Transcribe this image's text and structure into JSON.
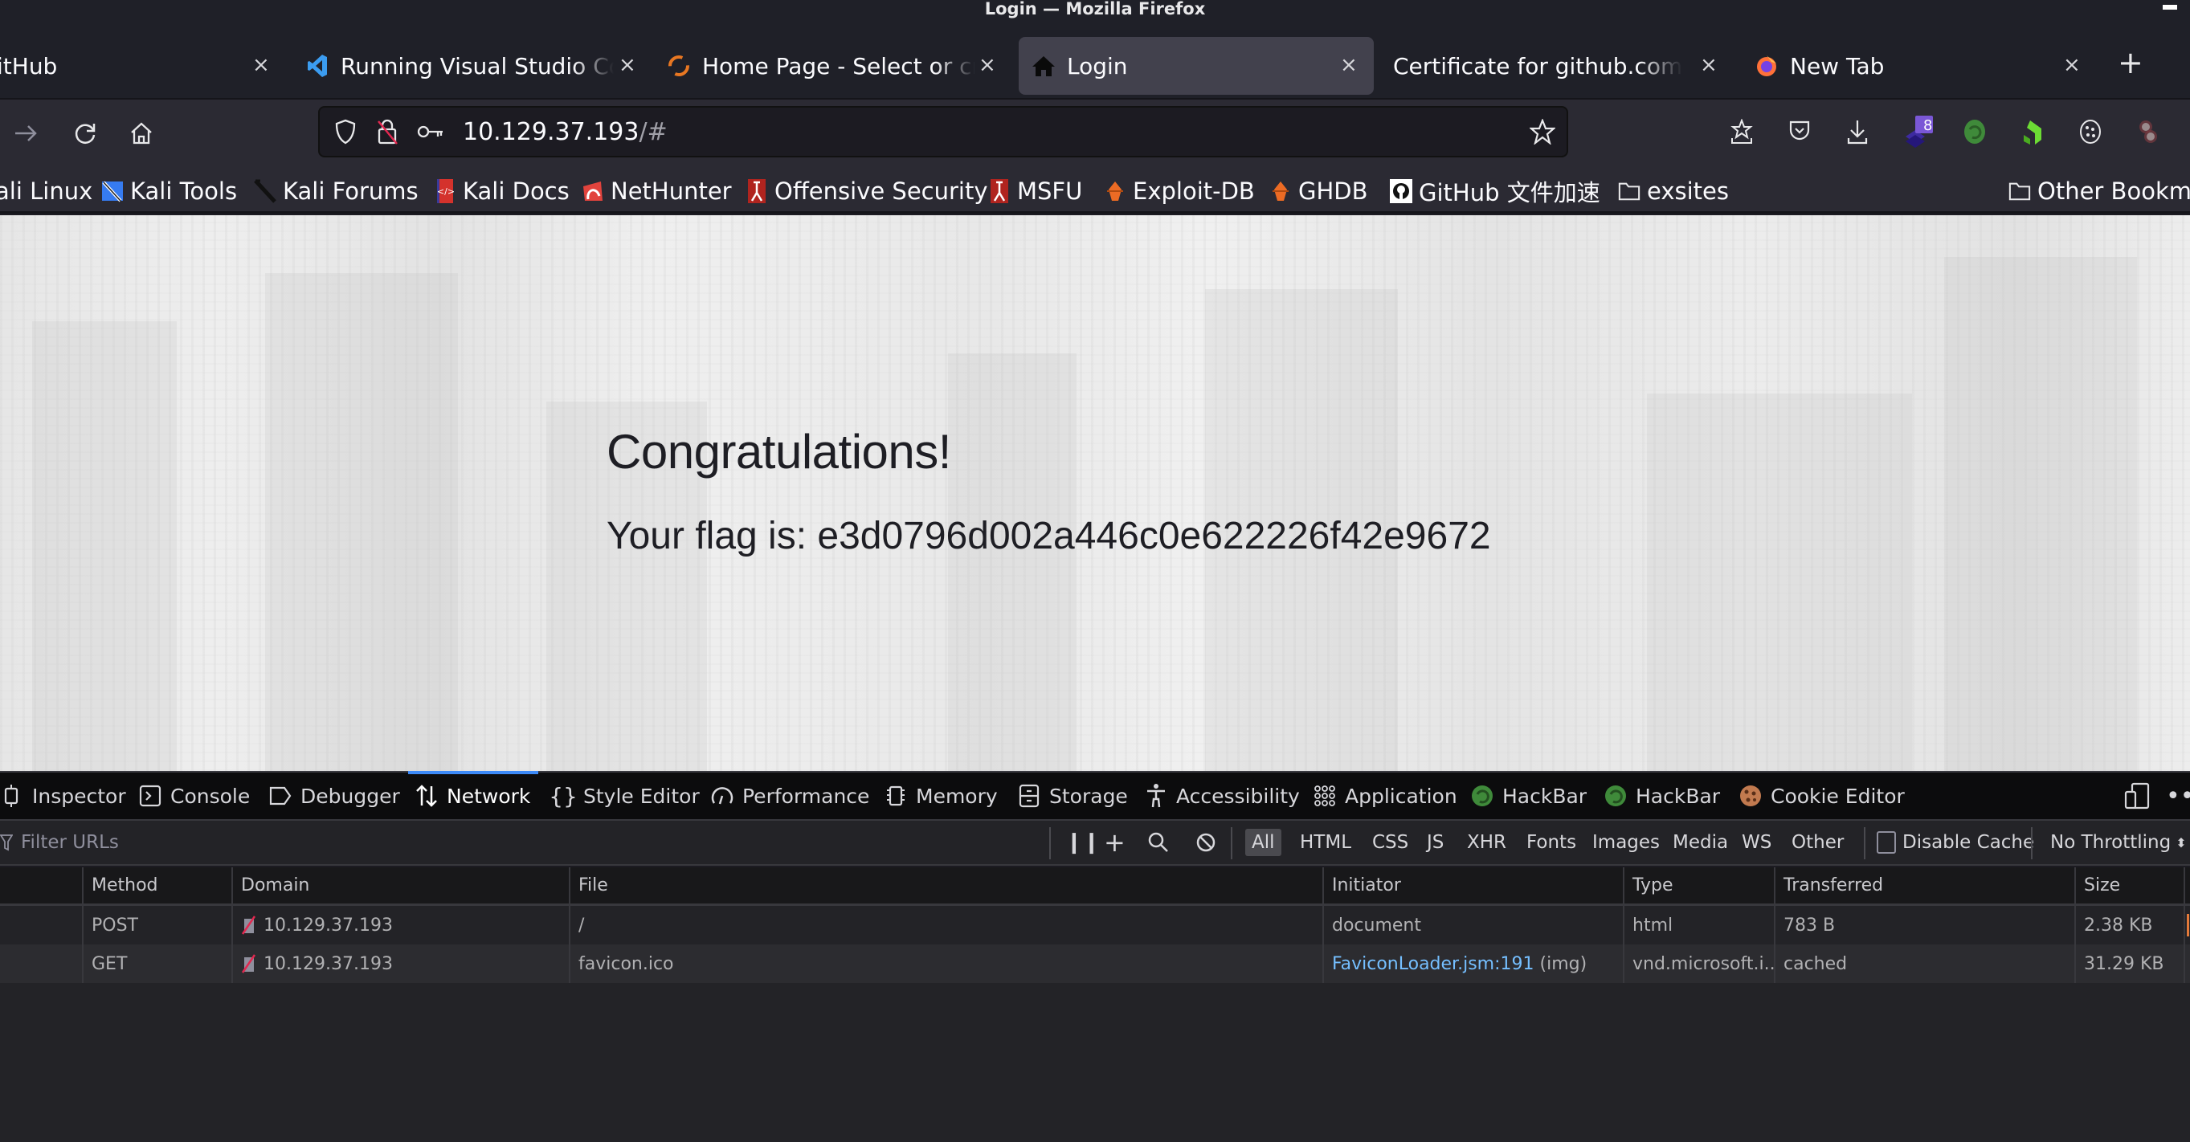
{
  "window": {
    "title": "Login — Mozilla Firefox"
  },
  "tabs": [
    {
      "label": "itHub",
      "icon": "github-icon",
      "active": false
    },
    {
      "label": "Running Visual Studio Code",
      "icon": "vscode-icon",
      "active": false
    },
    {
      "label": "Home Page - Select or create",
      "icon": "loading-spinner-icon",
      "active": false
    },
    {
      "label": "Login",
      "icon": "home-icon",
      "active": true
    },
    {
      "label": "Certificate for github.com",
      "icon": "",
      "active": false
    },
    {
      "label": "New Tab",
      "icon": "firefox-icon",
      "active": false
    }
  ],
  "tab_close_glyph": "×",
  "new_tab_glyph": "+",
  "navbar": {
    "url_host": "10.129.37.193",
    "url_hash": "/#",
    "extension_badge": "8"
  },
  "bookmarks": [
    {
      "label": "ali Linux",
      "icon": "kali-linux-icon"
    },
    {
      "label": "Kali Tools",
      "icon": "kali-tools-icon"
    },
    {
      "label": "Kali Forums",
      "icon": "kali-forums-icon"
    },
    {
      "label": "Kali Docs",
      "icon": "kali-docs-icon"
    },
    {
      "label": "NetHunter",
      "icon": "nethunter-icon"
    },
    {
      "label": "Offensive Security",
      "icon": "offsec-icon"
    },
    {
      "label": "MSFU",
      "icon": "msfu-icon"
    },
    {
      "label": "Exploit-DB",
      "icon": "exploit-db-icon"
    },
    {
      "label": "GHDB",
      "icon": "ghdb-icon"
    },
    {
      "label": "GitHub 文件加速",
      "icon": "github-icon"
    },
    {
      "label": "exsites",
      "icon": "folder-icon"
    }
  ],
  "other_bookmarks": "Other Bookmarks",
  "page": {
    "heading": "Congratulations!",
    "flag_text": "Your flag is: e3d0796d002a446c0e622226f42e9672"
  },
  "devtools": {
    "tabs": [
      {
        "label": "Inspector",
        "icon": "inspector-icon"
      },
      {
        "label": "Console",
        "icon": "console-icon"
      },
      {
        "label": "Debugger",
        "icon": "debugger-icon"
      },
      {
        "label": "Network",
        "icon": "network-icon",
        "active": true
      },
      {
        "label": "Style Editor",
        "icon": "style-editor-icon"
      },
      {
        "label": "Performance",
        "icon": "performance-icon"
      },
      {
        "label": "Memory",
        "icon": "memory-icon"
      },
      {
        "label": "Storage",
        "icon": "storage-icon"
      },
      {
        "label": "Accessibility",
        "icon": "accessibility-icon"
      },
      {
        "label": "Application",
        "icon": "application-icon"
      },
      {
        "label": "HackBar",
        "icon": "hackbar-icon"
      },
      {
        "label": "HackBar",
        "icon": "hackbar-icon"
      },
      {
        "label": "Cookie Editor",
        "icon": "cookie-icon"
      }
    ],
    "filter_placeholder": "Filter URLs",
    "type_filters": [
      "All",
      "HTML",
      "CSS",
      "JS",
      "XHR",
      "Fonts",
      "Images",
      "Media",
      "WS",
      "Other"
    ],
    "active_type_filter": "All",
    "disable_cache_label": "Disable Cache",
    "disable_cache_checked": false,
    "throttling": "No Throttling",
    "columns": [
      "Method",
      "Domain",
      "File",
      "Initiator",
      "Type",
      "Transferred",
      "Size"
    ],
    "requests": [
      {
        "method": "POST",
        "domain": "10.129.37.193",
        "file": "/",
        "initiator": "document",
        "initiator_extra": "",
        "type": "html",
        "transferred": "783 B",
        "size": "2.38 KB"
      },
      {
        "method": "GET",
        "domain": "10.129.37.193",
        "file": "favicon.ico",
        "initiator": "FaviconLoader.jsm:191",
        "initiator_extra": " (img)",
        "type": "vnd.microsoft.i...",
        "transferred": "cached",
        "size": "31.29 KB"
      }
    ]
  },
  "colors": {
    "accent": "#3d8af7",
    "link": "#75bfff",
    "insecure": "#e22850"
  }
}
